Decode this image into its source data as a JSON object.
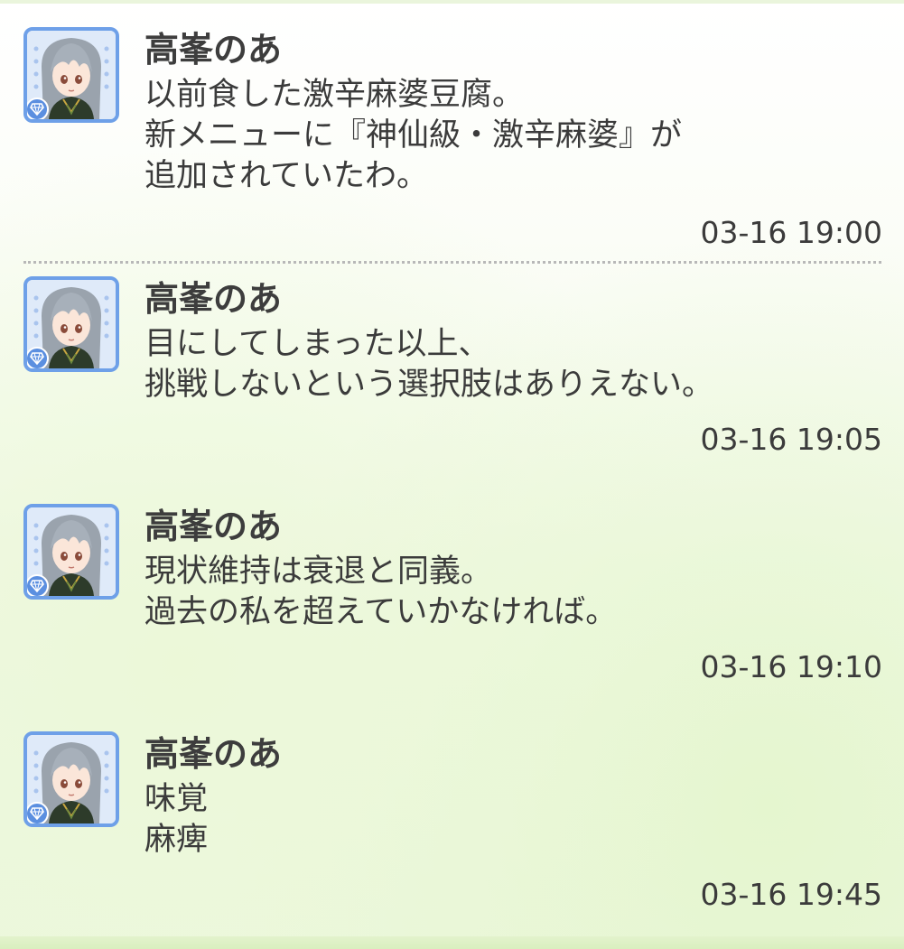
{
  "posts": [
    {
      "author": "高峯のあ",
      "message": "以前食した激辛麻婆豆腐。\n新メニューに『神仙級・激辛麻婆』が\n追加されていたわ。",
      "time": "03-16 19:00"
    },
    {
      "author": "高峯のあ",
      "message": "目にしてしまった以上、\n挑戦しないという選択肢はありえない。",
      "time": "03-16 19:05"
    },
    {
      "author": "高峯のあ",
      "message": "現状維持は衰退と同義。\n過去の私を超えていかなければ。",
      "time": "03-16 19:10"
    },
    {
      "author": "高峯のあ",
      "message": "味覚\n麻痺",
      "time": "03-16 19:45"
    }
  ],
  "colors": {
    "avatar_frame": "#6ea0e8",
    "text": "#3b3b3b",
    "divider": "#b8b8b8"
  },
  "icons": {
    "avatar": "character-portrait-icon",
    "badge": "diamond-gem-icon"
  }
}
